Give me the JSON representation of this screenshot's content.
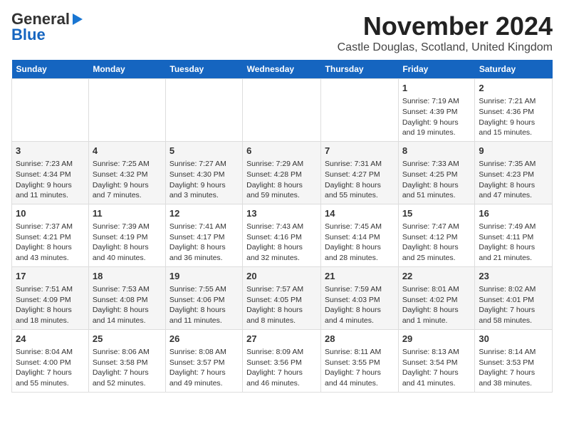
{
  "logo": {
    "general": "General",
    "blue": "Blue"
  },
  "header": {
    "month_year": "November 2024",
    "location": "Castle Douglas, Scotland, United Kingdom"
  },
  "weekdays": [
    "Sunday",
    "Monday",
    "Tuesday",
    "Wednesday",
    "Thursday",
    "Friday",
    "Saturday"
  ],
  "weeks": [
    [
      {
        "day": "",
        "info": ""
      },
      {
        "day": "",
        "info": ""
      },
      {
        "day": "",
        "info": ""
      },
      {
        "day": "",
        "info": ""
      },
      {
        "day": "",
        "info": ""
      },
      {
        "day": "1",
        "info": "Sunrise: 7:19 AM\nSunset: 4:39 PM\nDaylight: 9 hours\nand 19 minutes."
      },
      {
        "day": "2",
        "info": "Sunrise: 7:21 AM\nSunset: 4:36 PM\nDaylight: 9 hours\nand 15 minutes."
      }
    ],
    [
      {
        "day": "3",
        "info": "Sunrise: 7:23 AM\nSunset: 4:34 PM\nDaylight: 9 hours\nand 11 minutes."
      },
      {
        "day": "4",
        "info": "Sunrise: 7:25 AM\nSunset: 4:32 PM\nDaylight: 9 hours\nand 7 minutes."
      },
      {
        "day": "5",
        "info": "Sunrise: 7:27 AM\nSunset: 4:30 PM\nDaylight: 9 hours\nand 3 minutes."
      },
      {
        "day": "6",
        "info": "Sunrise: 7:29 AM\nSunset: 4:28 PM\nDaylight: 8 hours\nand 59 minutes."
      },
      {
        "day": "7",
        "info": "Sunrise: 7:31 AM\nSunset: 4:27 PM\nDaylight: 8 hours\nand 55 minutes."
      },
      {
        "day": "8",
        "info": "Sunrise: 7:33 AM\nSunset: 4:25 PM\nDaylight: 8 hours\nand 51 minutes."
      },
      {
        "day": "9",
        "info": "Sunrise: 7:35 AM\nSunset: 4:23 PM\nDaylight: 8 hours\nand 47 minutes."
      }
    ],
    [
      {
        "day": "10",
        "info": "Sunrise: 7:37 AM\nSunset: 4:21 PM\nDaylight: 8 hours\nand 43 minutes."
      },
      {
        "day": "11",
        "info": "Sunrise: 7:39 AM\nSunset: 4:19 PM\nDaylight: 8 hours\nand 40 minutes."
      },
      {
        "day": "12",
        "info": "Sunrise: 7:41 AM\nSunset: 4:17 PM\nDaylight: 8 hours\nand 36 minutes."
      },
      {
        "day": "13",
        "info": "Sunrise: 7:43 AM\nSunset: 4:16 PM\nDaylight: 8 hours\nand 32 minutes."
      },
      {
        "day": "14",
        "info": "Sunrise: 7:45 AM\nSunset: 4:14 PM\nDaylight: 8 hours\nand 28 minutes."
      },
      {
        "day": "15",
        "info": "Sunrise: 7:47 AM\nSunset: 4:12 PM\nDaylight: 8 hours\nand 25 minutes."
      },
      {
        "day": "16",
        "info": "Sunrise: 7:49 AM\nSunset: 4:11 PM\nDaylight: 8 hours\nand 21 minutes."
      }
    ],
    [
      {
        "day": "17",
        "info": "Sunrise: 7:51 AM\nSunset: 4:09 PM\nDaylight: 8 hours\nand 18 minutes."
      },
      {
        "day": "18",
        "info": "Sunrise: 7:53 AM\nSunset: 4:08 PM\nDaylight: 8 hours\nand 14 minutes."
      },
      {
        "day": "19",
        "info": "Sunrise: 7:55 AM\nSunset: 4:06 PM\nDaylight: 8 hours\nand 11 minutes."
      },
      {
        "day": "20",
        "info": "Sunrise: 7:57 AM\nSunset: 4:05 PM\nDaylight: 8 hours\nand 8 minutes."
      },
      {
        "day": "21",
        "info": "Sunrise: 7:59 AM\nSunset: 4:03 PM\nDaylight: 8 hours\nand 4 minutes."
      },
      {
        "day": "22",
        "info": "Sunrise: 8:01 AM\nSunset: 4:02 PM\nDaylight: 8 hours\nand 1 minute."
      },
      {
        "day": "23",
        "info": "Sunrise: 8:02 AM\nSunset: 4:01 PM\nDaylight: 7 hours\nand 58 minutes."
      }
    ],
    [
      {
        "day": "24",
        "info": "Sunrise: 8:04 AM\nSunset: 4:00 PM\nDaylight: 7 hours\nand 55 minutes."
      },
      {
        "day": "25",
        "info": "Sunrise: 8:06 AM\nSunset: 3:58 PM\nDaylight: 7 hours\nand 52 minutes."
      },
      {
        "day": "26",
        "info": "Sunrise: 8:08 AM\nSunset: 3:57 PM\nDaylight: 7 hours\nand 49 minutes."
      },
      {
        "day": "27",
        "info": "Sunrise: 8:09 AM\nSunset: 3:56 PM\nDaylight: 7 hours\nand 46 minutes."
      },
      {
        "day": "28",
        "info": "Sunrise: 8:11 AM\nSunset: 3:55 PM\nDaylight: 7 hours\nand 44 minutes."
      },
      {
        "day": "29",
        "info": "Sunrise: 8:13 AM\nSunset: 3:54 PM\nDaylight: 7 hours\nand 41 minutes."
      },
      {
        "day": "30",
        "info": "Sunrise: 8:14 AM\nSunset: 3:53 PM\nDaylight: 7 hours\nand 38 minutes."
      }
    ]
  ]
}
